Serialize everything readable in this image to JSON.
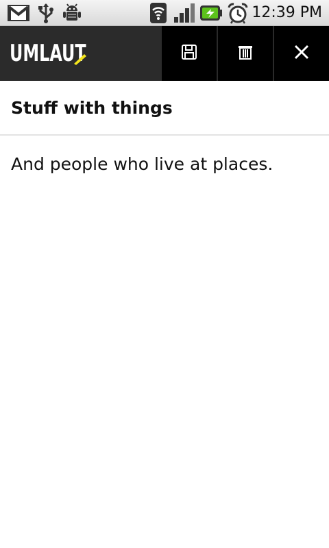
{
  "status_bar": {
    "time": "12:39 PM",
    "icons": [
      "gmail-icon",
      "usb-icon",
      "android-debug-icon",
      "wifi-icon",
      "signal-icon",
      "battery-charging-icon",
      "alarm-icon"
    ]
  },
  "action_bar": {
    "app_name": "UMLAUT",
    "accent_color": "#f4e51c",
    "buttons": [
      "save-icon",
      "delete-icon",
      "close-icon"
    ]
  },
  "note": {
    "title": "Stuff with things",
    "body": "And people who live at places."
  }
}
